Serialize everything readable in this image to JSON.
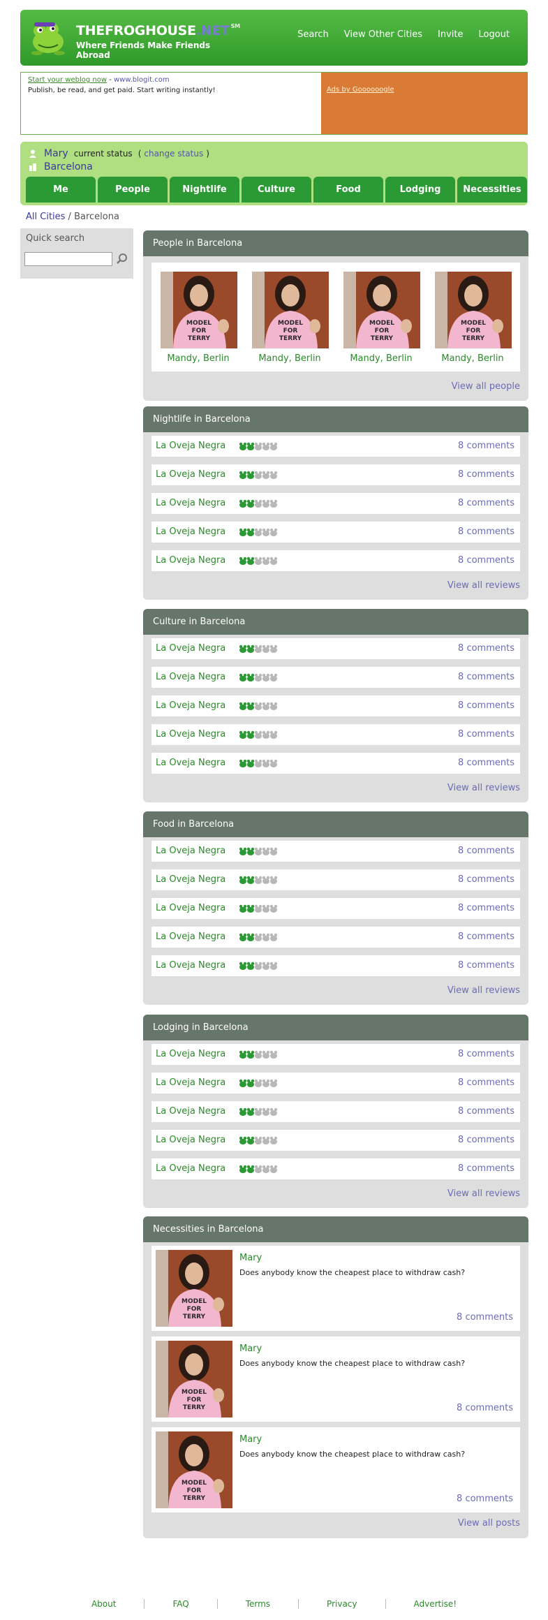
{
  "brand": {
    "name_main": "THEFROGHOUSE",
    "name_net": ".NET",
    "name_sm": "SM",
    "tagline": "Where Friends Make Friends Abroad"
  },
  "topnav": [
    "Search",
    "View Other Cities",
    "Invite",
    "Logout"
  ],
  "ads": {
    "link_text": "Start your weblog now",
    "separator": " - ",
    "url_text": "www.blogit.com",
    "body": "Publish, be read, and get paid. Start writing instantly!",
    "google": "Ads by Goooooogle",
    "color": "#d97a35"
  },
  "status": {
    "user": "Mary",
    "current_status": "current status",
    "open_paren": "(",
    "change": "change status",
    "close_paren": ")",
    "city": "Barcelona"
  },
  "tabs": [
    "Me",
    "People",
    "Nightlife",
    "Culture",
    "Food",
    "Lodging",
    "Necessities"
  ],
  "breadcrumb": {
    "all": "All Cities",
    "sep": " / ",
    "current": "Barcelona"
  },
  "sidebar": {
    "title": "Quick search",
    "search_value": ""
  },
  "people": {
    "title": "People in Barcelona",
    "items": [
      {
        "name": "Mandy, Berlin"
      },
      {
        "name": "Mandy, Berlin"
      },
      {
        "name": "Mandy, Berlin"
      },
      {
        "name": "Mandy, Berlin"
      }
    ],
    "more": "View all people"
  },
  "nightlife": {
    "title": "Nightlife in Barcelona",
    "rows": [
      {
        "name": "La Oveja Negra",
        "rating": 2,
        "comments": "8 comments"
      },
      {
        "name": "La Oveja Negra",
        "rating": 2,
        "comments": "8 comments"
      },
      {
        "name": "La Oveja Negra",
        "rating": 2,
        "comments": "8 comments"
      },
      {
        "name": "La Oveja Negra",
        "rating": 2,
        "comments": "8 comments"
      },
      {
        "name": "La Oveja Negra",
        "rating": 2,
        "comments": "8 comments"
      }
    ],
    "more": "View all reviews"
  },
  "culture": {
    "title": "Culture in Barcelona",
    "rows": [
      {
        "name": "La Oveja Negra",
        "rating": 2,
        "comments": "8 comments"
      },
      {
        "name": "La Oveja Negra",
        "rating": 2,
        "comments": "8 comments"
      },
      {
        "name": "La Oveja Negra",
        "rating": 2,
        "comments": "8 comments"
      },
      {
        "name": "La Oveja Negra",
        "rating": 2,
        "comments": "8 comments"
      },
      {
        "name": "La Oveja Negra",
        "rating": 2,
        "comments": "8 comments"
      }
    ],
    "more": "View all reviews"
  },
  "food": {
    "title": "Food in Barcelona",
    "rows": [
      {
        "name": "La Oveja Negra",
        "rating": 2,
        "comments": "8 comments"
      },
      {
        "name": "La Oveja Negra",
        "rating": 2,
        "comments": "8 comments"
      },
      {
        "name": "La Oveja Negra",
        "rating": 2,
        "comments": "8 comments"
      },
      {
        "name": "La Oveja Negra",
        "rating": 2,
        "comments": "8 comments"
      },
      {
        "name": "La Oveja Negra",
        "rating": 2,
        "comments": "8 comments"
      }
    ],
    "more": "View all reviews"
  },
  "lodging": {
    "title": "Lodging in Barcelona",
    "rows": [
      {
        "name": "La Oveja Negra",
        "rating": 2,
        "comments": "8 comments"
      },
      {
        "name": "La Oveja Negra",
        "rating": 2,
        "comments": "8 comments"
      },
      {
        "name": "La Oveja Negra",
        "rating": 2,
        "comments": "8 comments"
      },
      {
        "name": "La Oveja Negra",
        "rating": 2,
        "comments": "8 comments"
      },
      {
        "name": "La Oveja Negra",
        "rating": 2,
        "comments": "8 comments"
      }
    ],
    "more": "View all reviews"
  },
  "necessities": {
    "title": "Necessities in Barcelona",
    "posts": [
      {
        "user": "Mary",
        "text": "Does anybody know the cheapest place to withdraw cash?",
        "comments": "8 comments"
      },
      {
        "user": "Mary",
        "text": "Does anybody know the cheapest place to withdraw cash?",
        "comments": "8 comments"
      },
      {
        "user": "Mary",
        "text": "Does anybody know the cheapest place to withdraw cash?",
        "comments": "8 comments"
      }
    ],
    "more": "View all posts"
  },
  "photo_caption_lines": [
    "MODEL",
    "FOR",
    "TERRY"
  ],
  "footer": [
    "About",
    "FAQ",
    "Terms",
    "Privacy",
    "Advertise!"
  ],
  "colors": {
    "header_green": "#2f9a2a",
    "tab_green": "#2b9934",
    "status_bg": "#b0df82",
    "section_header": "#67766a",
    "link_green": "#2b8a2a",
    "link_purple": "#6b6bb8"
  }
}
